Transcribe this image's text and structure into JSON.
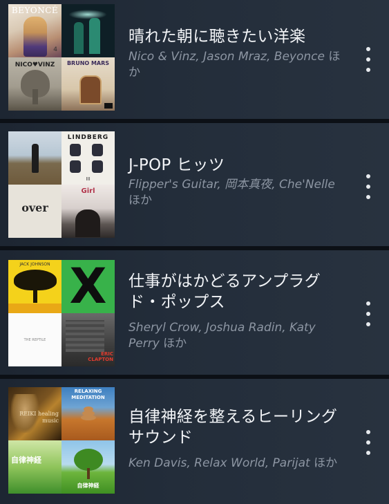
{
  "playlists": [
    {
      "title": "晴れた朝に聴きたい洋楽",
      "artists": "Nico & Vinz, Jason Mraz, Beyonce",
      "suffix": "ほか",
      "covers": {
        "tl": "BEYONCÉ",
        "tr_num": "4",
        "bl": "NICO♥VINZ",
        "br": "BRUNO MARS"
      }
    },
    {
      "title": "J-POP ヒッツ",
      "artists": "Flipper's Guitar, 岡本真夜, Che'Nelle",
      "suffix": "ほか",
      "covers": {
        "tr": "LINDBERG",
        "tr_num": "III",
        "bl": "over",
        "br": "Girl"
      }
    },
    {
      "title": "仕事がはかどるアンプラグド・ポップス",
      "artists": "Sheryl Crow, Joshua Radin, Katy Perry",
      "suffix": "ほか",
      "covers": {
        "tl": "JACK JOHNSON",
        "tr": "X",
        "bl": "THE REPTILE",
        "br": "ERIC CLAPTON"
      }
    },
    {
      "title": "自律神経を整えるヒーリングサウンド",
      "artists": "Ken Davis, Relax World, Parijat",
      "suffix": "ほか",
      "covers": {
        "tl": "REIKI healing music",
        "tr": "RELAXING MEDITATION",
        "bl": "自律神経",
        "br": "自律神経"
      }
    }
  ],
  "icons": {
    "more": "more-vertical-icon"
  },
  "colors": {
    "background": "#0c1016",
    "row": "#232d3a",
    "title": "#f2f4f7",
    "artists": "#8d96a3"
  }
}
